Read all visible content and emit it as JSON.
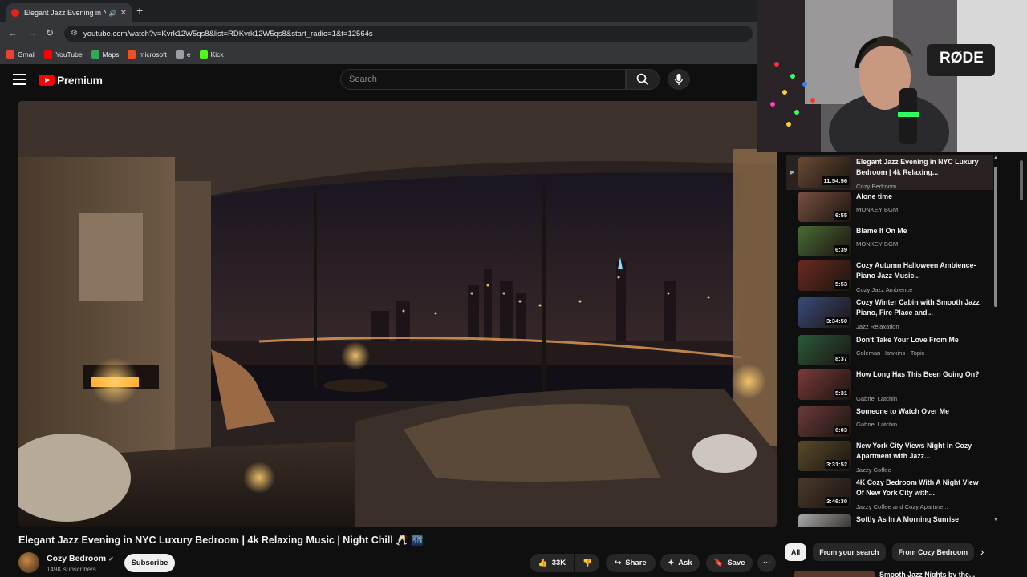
{
  "browser": {
    "tab_title": "Elegant Jazz Evening in NYC",
    "url": "youtube.com/watch?v=Kvrk12W5qs8&list=RDKvrk12W5qs8&start_radio=1&t=12564s",
    "bookmarks": [
      {
        "label": "Gmail",
        "icon": "gmail-icon",
        "color": "#ea4335"
      },
      {
        "label": "YouTube",
        "icon": "youtube-icon",
        "color": "#ff0000"
      },
      {
        "label": "Maps",
        "icon": "maps-icon",
        "color": "#34a853"
      },
      {
        "label": "microsoft",
        "icon": "microsoft-icon",
        "color": "#f25022"
      },
      {
        "label": "e",
        "icon": "globe-icon",
        "color": "#9aa0a6"
      },
      {
        "label": "Kick",
        "icon": "kick-icon",
        "color": "#53fc18"
      }
    ]
  },
  "header": {
    "logo_text": "Premium",
    "search_placeholder": "Search"
  },
  "video": {
    "title": "Elegant Jazz Evening in NYC Luxury Bedroom | 4k Relaxing Music | Night Chill 🥂 🌃",
    "channel": "Cozy Bedroom",
    "subscribers": "149K subscribers",
    "subscribe_label": "Subscribe",
    "likes": "33K",
    "share_label": "Share",
    "ask_label": "Ask",
    "save_label": "Save"
  },
  "webcam": {
    "mic_brand": "RØDE"
  },
  "playlist": {
    "items": [
      {
        "title": "Elegant Jazz Evening in NYC Luxury Bedroom | 4k Relaxing...",
        "channel": "Cozy Bedroom",
        "duration": "11:54:56",
        "active": true
      },
      {
        "title": "Alone time",
        "channel": "MONKEY BGM",
        "duration": "6:55"
      },
      {
        "title": "Blame It On Me",
        "channel": "MONKEY BGM",
        "duration": "6:39"
      },
      {
        "title": "Cozy Autumn Halloween Ambience- Piano Jazz Music...",
        "channel": "Cozy Jazz Ambience",
        "duration": "5:53"
      },
      {
        "title": "Cozy Winter Cabin with Smooth Jazz Piano, Fire Place and...",
        "channel": "Jazz Relaxation",
        "duration": "3:34:50"
      },
      {
        "title": "Don't Take Your Love From Me",
        "channel": "Coleman Hawkins - Topic",
        "duration": "8:37"
      },
      {
        "title": "How Long Has This Been Going On?",
        "channel": "Gabriel Latchin",
        "duration": "5:31"
      },
      {
        "title": "Someone to Watch Over Me",
        "channel": "Gabriel Latchin",
        "duration": "6:03"
      },
      {
        "title": "New York City Views Night in Cozy Apartment with Jazz...",
        "channel": "Jazzy Coffee",
        "duration": "3:31:52"
      },
      {
        "title": "4K Cozy Bedroom With A Night View Of New York City with...",
        "channel": "Jazzy Coffee and Cozy Apartme...",
        "duration": "3:46:30"
      },
      {
        "title": "Softly As In A Morning Sunrise",
        "channel": "",
        "duration": ""
      }
    ]
  },
  "chips": [
    "All",
    "From your search",
    "From Cozy Bedroom"
  ],
  "recommended_peek": "Smooth Jazz Nights by the..."
}
